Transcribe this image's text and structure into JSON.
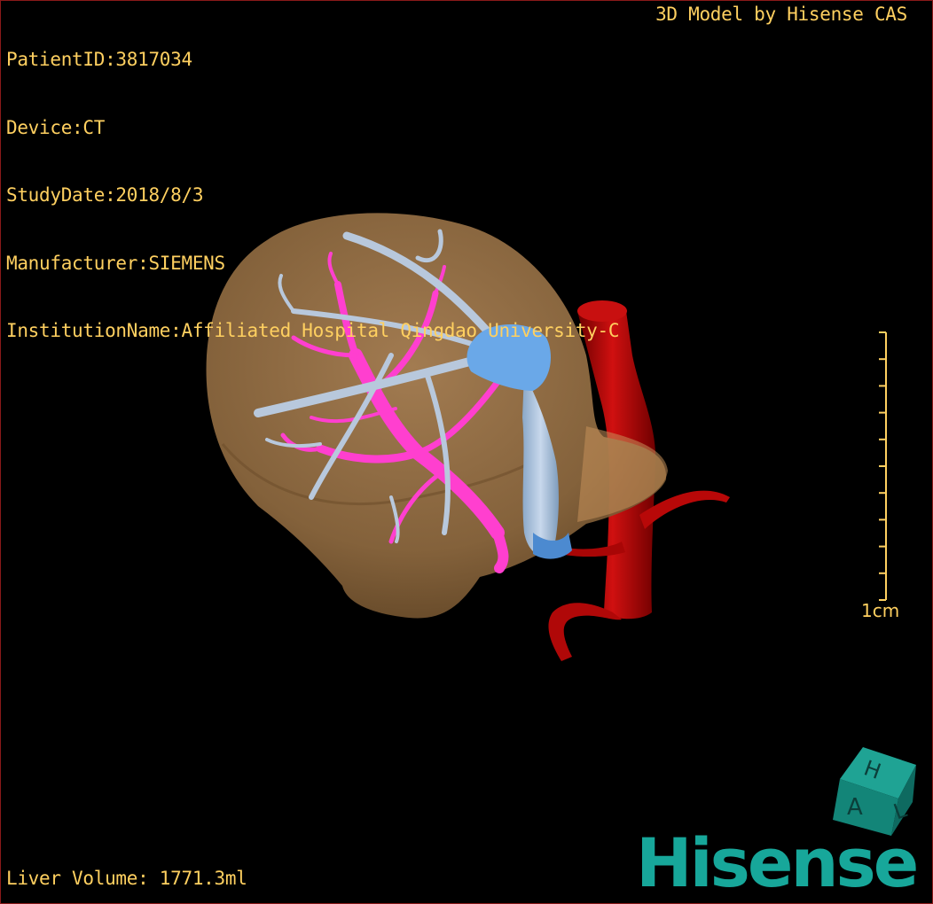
{
  "patient_info": {
    "patient_id": "PatientID:3817034",
    "device": "Device:CT",
    "study_date": "StudyDate:2018/8/3",
    "manufacturer": "Manufacturer:SIEMENS",
    "institution": "InstitutionName:Affiliated Hospital Qingdao University-C"
  },
  "credit": "3D Model by Hisense CAS",
  "liver_volume": "Liver Volume: 1771.3ml",
  "scale": {
    "label": "1cm",
    "tick_count": 11
  },
  "logo": {
    "brand": "Hisense",
    "cube_letters": [
      "H",
      "A",
      "L"
    ]
  },
  "colors": {
    "overlay_text": "#ffd060",
    "liver": "#a0784a",
    "hepatic_vein": "#b8c8dc",
    "portal_vein": "#ff3fcf",
    "ivc": "#6aa8e8",
    "aorta": "#b30000",
    "brand": "#17a79a"
  }
}
